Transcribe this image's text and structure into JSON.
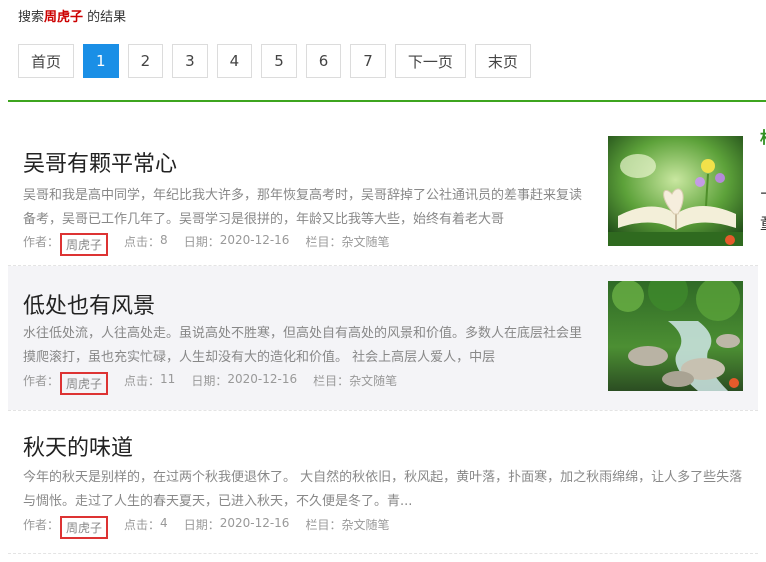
{
  "search": {
    "prefix": "搜索",
    "keyword": "周虎子",
    "suffix": " 的结果"
  },
  "pager": {
    "first": "首页",
    "pages": [
      "1",
      "2",
      "3",
      "4",
      "5",
      "6",
      "7"
    ],
    "current": "1",
    "next": "下一页",
    "last": "末页"
  },
  "side": {
    "char1": "相",
    "char2": "飞",
    "char3": "童"
  },
  "posts": [
    {
      "title": "吴哥有颗平常心",
      "excerpt": "吴哥和我是高中同学，年纪比我大许多，那年恢复高考时，吴哥辞掉了公社通讯员的差事赶来复读备考，吴哥已工作几年了。吴哥学习是很拼的，年龄又比我等大些，始终有着老大哥",
      "author_label": "作者：",
      "author": "周虎子",
      "clicks_label": "点击：",
      "clicks": "8",
      "date_label": "日期：",
      "date": "2020-12-16",
      "column_label": "栏目：",
      "column": "杂文随笔"
    },
    {
      "title": "低处也有风景",
      "excerpt": "水往低处流，人往高处走。虽说高处不胜寒，但高处自有高处的风景和价值。多数人在底层社会里摸爬滚打，虽也充实忙碌，人生却没有大的造化和价值。 社会上高层人爱人，中层",
      "author_label": "作者：",
      "author": "周虎子",
      "clicks_label": "点击：",
      "clicks": "11",
      "date_label": "日期：",
      "date": "2020-12-16",
      "column_label": "栏目：",
      "column": "杂文随笔"
    },
    {
      "title": "秋天的味道",
      "excerpt": "今年的秋天是别样的，在过两个秋我便退休了。 大自然的秋依旧，秋风起，黄叶落，扑面寒，加之秋雨绵绵，让人多了些失落与惆怅。走过了人生的春天夏天，已进入秋天，不久便是冬了。青...",
      "author_label": "作者：",
      "author": "周虎子",
      "clicks_label": "点击：",
      "clicks": "4",
      "date_label": "日期：",
      "date": "2020-12-16",
      "column_label": "栏目：",
      "column": "杂文随笔"
    }
  ]
}
